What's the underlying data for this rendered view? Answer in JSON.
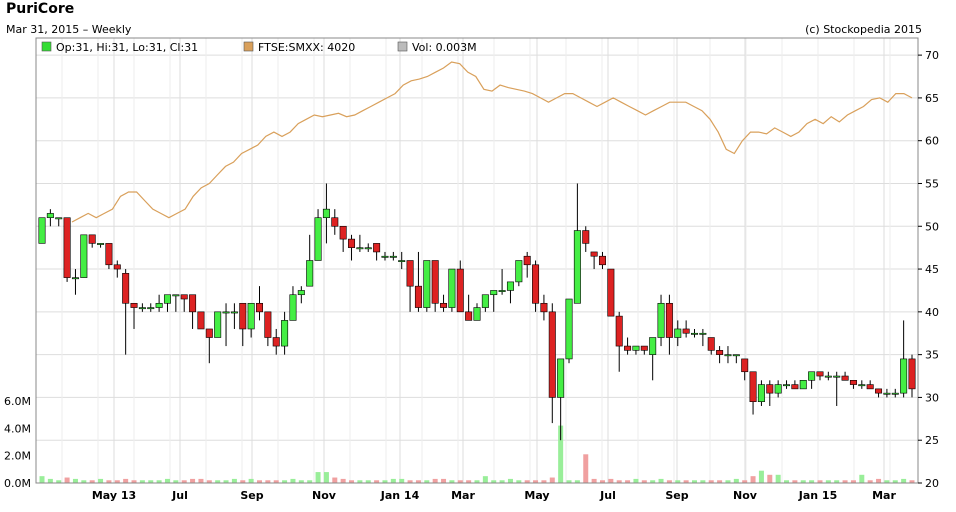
{
  "header": {
    "title": "PuriCore",
    "subtitle": "Mar 31, 2015 – Weekly",
    "copyright": "(c) Stockopedia 2015"
  },
  "legend": [
    {
      "label": "Op:31, Hi:31, Lo:31, Cl:31",
      "color": "#33dd33"
    },
    {
      "label": "FTSE:SMXX: 4020",
      "color": "#d9a05b"
    },
    {
      "label": "Vol: 0.003M",
      "color": "#bbbbbb"
    }
  ],
  "colors": {
    "up": "#44ee44",
    "down": "#dd2222",
    "index_line": "#d9a05b",
    "grid": "#dddddd"
  },
  "chart_data": {
    "type": "candlestick",
    "x_ticks": [
      "May 13",
      "Jul",
      "Sep",
      "Nov",
      "Jan 14",
      "Mar",
      "May",
      "Jul",
      "Sep",
      "Nov",
      "Jan 15",
      "Mar"
    ],
    "y_price_ticks": [
      "70",
      "65",
      "60",
      "55",
      "50",
      "45",
      "40",
      "35",
      "30",
      "25",
      "20"
    ],
    "y_volume_ticks": [
      "6.0M",
      "4.0M",
      "2.0M",
      "0.0M"
    ],
    "ylim_price": [
      20,
      72
    ],
    "ylim_volume": [
      0,
      7
    ],
    "candles": [
      [
        48,
        51,
        48,
        51
      ],
      [
        51,
        52,
        50,
        51.5
      ],
      [
        51,
        51,
        50,
        51
      ],
      [
        51,
        51,
        43.5,
        44
      ],
      [
        44,
        45,
        42,
        44
      ],
      [
        44,
        49,
        44,
        49
      ],
      [
        49,
        49,
        47.5,
        48
      ],
      [
        48,
        48,
        47.5,
        48
      ],
      [
        48,
        48,
        45,
        45.5
      ],
      [
        45.5,
        46,
        44,
        45
      ],
      [
        44.5,
        45,
        35,
        41
      ],
      [
        41,
        41,
        38,
        40.5
      ],
      [
        40.5,
        41,
        40,
        40.5
      ],
      [
        40.5,
        41,
        40,
        40.5
      ],
      [
        40.5,
        42,
        40,
        41
      ],
      [
        41,
        42,
        40,
        42
      ],
      [
        42,
        42,
        40,
        42
      ],
      [
        42,
        42,
        40,
        41.5
      ],
      [
        42,
        42,
        38,
        40
      ],
      [
        40,
        40,
        38,
        38
      ],
      [
        38,
        38,
        34,
        37
      ],
      [
        37,
        40,
        37,
        40
      ],
      [
        40,
        41,
        36,
        40
      ],
      [
        40,
        41,
        38,
        40
      ],
      [
        41,
        41,
        36,
        38
      ],
      [
        38,
        41,
        37,
        41
      ],
      [
        41,
        43,
        39,
        40
      ],
      [
        40,
        40,
        36,
        37
      ],
      [
        37,
        38,
        35,
        36
      ],
      [
        36,
        40,
        35,
        39
      ],
      [
        39,
        43,
        39,
        42
      ],
      [
        42,
        43,
        41,
        42.5
      ],
      [
        43,
        49,
        43,
        46
      ],
      [
        46,
        52,
        46,
        51
      ],
      [
        51,
        55,
        48,
        52
      ],
      [
        51,
        52,
        49,
        50
      ],
      [
        50,
        50,
        47,
        48.5
      ],
      [
        48.5,
        49,
        46,
        47.5
      ],
      [
        47.5,
        49,
        47,
        47.5
      ],
      [
        47.5,
        48,
        47,
        47.5
      ],
      [
        48,
        48,
        46,
        47
      ],
      [
        46.5,
        47,
        46,
        46.5
      ],
      [
        46.5,
        47,
        46,
        46.5
      ],
      [
        46,
        47,
        45,
        46
      ],
      [
        46,
        46,
        40,
        43
      ],
      [
        43,
        47,
        40,
        40.5
      ],
      [
        40.5,
        45,
        40,
        46
      ],
      [
        46,
        46,
        40,
        41
      ],
      [
        41,
        42,
        40,
        40.5
      ],
      [
        40.5,
        45,
        40,
        45
      ],
      [
        45,
        46,
        40,
        40
      ],
      [
        40,
        42,
        39,
        39
      ],
      [
        39,
        41,
        39,
        40.5
      ],
      [
        40.5,
        42,
        40,
        42
      ],
      [
        42,
        42,
        40,
        42.5
      ],
      [
        42.5,
        45,
        42,
        42.5
      ],
      [
        42.5,
        43,
        41,
        43.5
      ],
      [
        43.5,
        46,
        43,
        46
      ],
      [
        46.5,
        47,
        44,
        45.5
      ],
      [
        45.5,
        46,
        40,
        41
      ],
      [
        41,
        42,
        39,
        40
      ],
      [
        40,
        41,
        27,
        30
      ],
      [
        30,
        30,
        25,
        34.5
      ],
      [
        34.5,
        36,
        34,
        41.5
      ],
      [
        41,
        55,
        41,
        49.5
      ],
      [
        49.5,
        50,
        47,
        48
      ],
      [
        47,
        47,
        45,
        46.5
      ],
      [
        46.5,
        47,
        45,
        45.5
      ],
      [
        45,
        45,
        40,
        39.5
      ],
      [
        39.5,
        40,
        33,
        36
      ],
      [
        36,
        37,
        35,
        35.5
      ],
      [
        35.5,
        36,
        35,
        36
      ],
      [
        36,
        36,
        35,
        35.5
      ],
      [
        35,
        36,
        32,
        37
      ],
      [
        37,
        42,
        36,
        41
      ],
      [
        41,
        42,
        35,
        37
      ],
      [
        37,
        39,
        36,
        38
      ],
      [
        38,
        39,
        37,
        37.5
      ],
      [
        37.5,
        38,
        37,
        37.5
      ],
      [
        37.5,
        38,
        36,
        37.5
      ],
      [
        37,
        37,
        35,
        35.5
      ],
      [
        35.5,
        36,
        34,
        35
      ],
      [
        35,
        36,
        34,
        35
      ],
      [
        35,
        35,
        34,
        35
      ],
      [
        34.5,
        34.5,
        32,
        33
      ],
      [
        33,
        33,
        28,
        29.5
      ],
      [
        29.5,
        32,
        29,
        31.5
      ],
      [
        31.5,
        32,
        29,
        30.5
      ],
      [
        30.5,
        32,
        30,
        31.5
      ],
      [
        31.5,
        32,
        31,
        31.5
      ],
      [
        31.5,
        32,
        31,
        31
      ],
      [
        31,
        32,
        31,
        32
      ],
      [
        32,
        33,
        31,
        33
      ],
      [
        33,
        33,
        32,
        32.5
      ],
      [
        32.5,
        33,
        32,
        32.5
      ],
      [
        32.5,
        33,
        29,
        32.5
      ],
      [
        32.5,
        33,
        32,
        32
      ],
      [
        32,
        32,
        31,
        31.5
      ],
      [
        31.5,
        32,
        31,
        31.5
      ],
      [
        31.5,
        32,
        31,
        31
      ],
      [
        31,
        31,
        30,
        30.5
      ],
      [
        30.5,
        31,
        30,
        30.5
      ],
      [
        30.5,
        31,
        30,
        30.5
      ],
      [
        30.5,
        39,
        30,
        34.5
      ],
      [
        34.5,
        35,
        30,
        31
      ]
    ],
    "index_series": [
      {
        "name": "FTSE:SMXX",
        "values": [
          50.5,
          51,
          51.5,
          51,
          51.5,
          52,
          53.5,
          54,
          54,
          53,
          52,
          51.5,
          51,
          51.5,
          52,
          53.5,
          54.5,
          55,
          56,
          57,
          57.5,
          58.5,
          59,
          59.5,
          60.5,
          61,
          60.5,
          61,
          62,
          62.5,
          63,
          62.8,
          63,
          63.2,
          62.8,
          63,
          63.5,
          64,
          64.5,
          65,
          65.5,
          66.5,
          67,
          67.2,
          67.5,
          68,
          68.5,
          69.2,
          69,
          68,
          67.5,
          66,
          65.8,
          66.5,
          66.2,
          66,
          65.8,
          65.5,
          65,
          64.5,
          65,
          65.5,
          65.5,
          65,
          64.5,
          64,
          64.5,
          65,
          64.5,
          64,
          63.5,
          63,
          63.5,
          64,
          64.5,
          64.5,
          64.5,
          64,
          63.5,
          62.5,
          61,
          59,
          58.5,
          60,
          61,
          61,
          60.8,
          61.5,
          61,
          60.5,
          61,
          62,
          62.5,
          62,
          62.8,
          62.2,
          63,
          63.5,
          64,
          64.8,
          65,
          64.5,
          65.5,
          65.5,
          65
        ]
      }
    ],
    "volume": [
      0.5,
      0.3,
      0.2,
      0.4,
      0.3,
      0.2,
      0.2,
      0.3,
      0.2,
      0.2,
      0.3,
      0.2,
      0.2,
      0.2,
      0.2,
      0.3,
      0.2,
      0.2,
      0.3,
      0.3,
      0.2,
      0.2,
      0.2,
      0.3,
      0.2,
      0.3,
      0.2,
      0.2,
      0.2,
      0.2,
      0.3,
      0.2,
      0.2,
      0.8,
      0.8,
      0.4,
      0.3,
      0.2,
      0.2,
      0.2,
      0.2,
      0.2,
      0.3,
      0.3,
      0.2,
      0.2,
      0.2,
      0.3,
      0.3,
      0.2,
      0.2,
      0.2,
      0.2,
      0.5,
      0.2,
      0.2,
      0.3,
      0.2,
      0.2,
      0.2,
      0.2,
      0.4,
      4.2,
      0.2,
      0.2,
      2.1,
      0.3,
      0.2,
      0.3,
      0.2,
      0.2,
      0.3,
      0.2,
      0.2,
      0.3,
      0.2,
      0.2,
      0.2,
      0.2,
      0.2,
      0.2,
      0.2,
      0.2,
      0.3,
      0.2,
      0.5,
      0.9,
      0.6,
      0.6,
      0.2,
      0.2,
      0.2,
      0.2,
      0.2,
      0.2,
      0.2,
      0.2,
      0.2,
      0.6,
      0.2,
      0.3,
      0.2,
      0.2,
      0.3,
      0.2
    ]
  }
}
